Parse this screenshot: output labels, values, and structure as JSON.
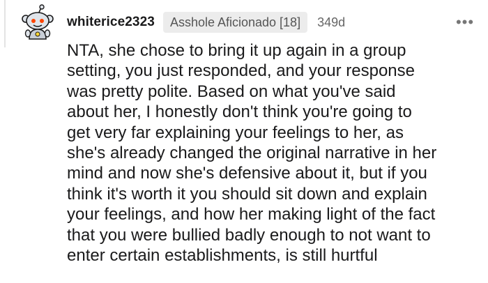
{
  "comment": {
    "author": "whiterice2323",
    "flair": "Asshole Aficionado [18]",
    "age": "349d",
    "more_label": "•••",
    "body": "NTA, she chose to bring it up again in a group\nsetting, you just responded, and your response\nwas pretty polite. Based on what you've said\nabout her, I honestly don't think you're going to\nget very far explaining your feelings to her, as\nshe's already changed the original narrative in her\nmind and now she's defensive about it, but if you\nthink it's worth it you should sit down and explain\nyour feelings, and how her making light of the fact\nthat you were bullied badly enough to not want to\nenter certain establishments, is still hurtful"
  },
  "icons": {
    "avatar": "reddit-snoo-avatar-icon",
    "more": "more-options-icon"
  },
  "colors": {
    "text": "#1a1a1b",
    "flair_bg": "#ececec",
    "muted": "#666666"
  }
}
